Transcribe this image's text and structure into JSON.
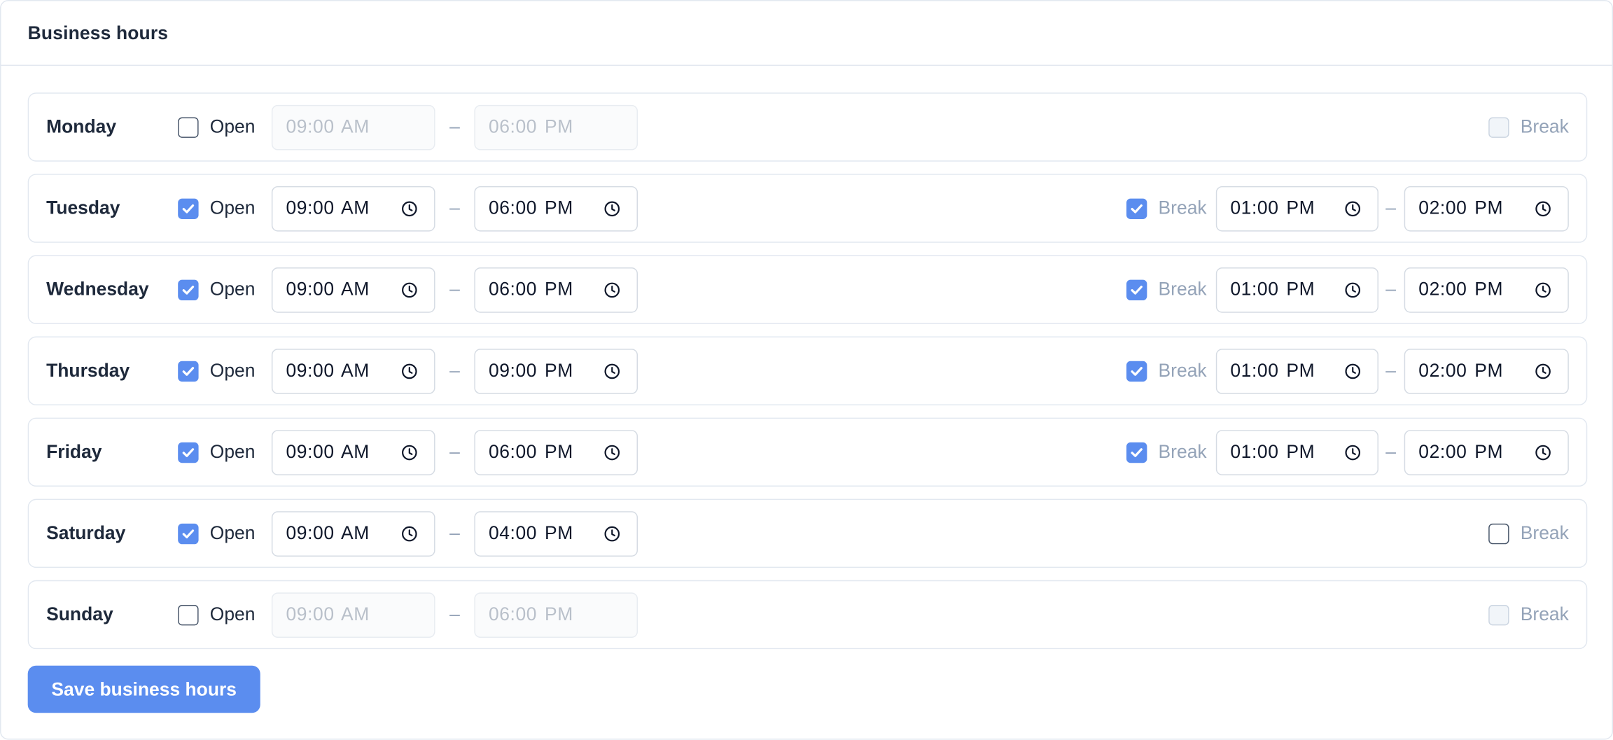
{
  "card": {
    "title": "Business hours"
  },
  "labels": {
    "open": "Open",
    "break": "Break",
    "separator": "–"
  },
  "days": [
    {
      "name": "Monday",
      "open": false,
      "open_time": "09:00 AM",
      "close_time": "06:00 PM",
      "break": false,
      "break_enabled": false,
      "break_start": "",
      "break_end": ""
    },
    {
      "name": "Tuesday",
      "open": true,
      "open_time": "09:00 AM",
      "close_time": "06:00 PM",
      "break": true,
      "break_enabled": true,
      "break_start": "01:00 PM",
      "break_end": "02:00 PM"
    },
    {
      "name": "Wednesday",
      "open": true,
      "open_time": "09:00 AM",
      "close_time": "06:00 PM",
      "break": true,
      "break_enabled": true,
      "break_start": "01:00 PM",
      "break_end": "02:00 PM"
    },
    {
      "name": "Thursday",
      "open": true,
      "open_time": "09:00 AM",
      "close_time": "09:00 PM",
      "break": true,
      "break_enabled": true,
      "break_start": "01:00 PM",
      "break_end": "02:00 PM"
    },
    {
      "name": "Friday",
      "open": true,
      "open_time": "09:00 AM",
      "close_time": "06:00 PM",
      "break": true,
      "break_enabled": true,
      "break_start": "01:00 PM",
      "break_end": "02:00 PM"
    },
    {
      "name": "Saturday",
      "open": true,
      "open_time": "09:00 AM",
      "close_time": "04:00 PM",
      "break": false,
      "break_enabled": true,
      "break_start": "",
      "break_end": ""
    },
    {
      "name": "Sunday",
      "open": false,
      "open_time": "09:00 AM",
      "close_time": "06:00 PM",
      "break": false,
      "break_enabled": false,
      "break_start": "",
      "break_end": ""
    }
  ],
  "actions": {
    "save_label": "Save business hours"
  },
  "colors": {
    "accent": "#5b8def",
    "border": "#e2e8f0",
    "text": "#1e293b",
    "muted": "#94a3b8"
  },
  "icons": {
    "time_input": "clock-icon",
    "checkbox_checked": "checkmark-icon"
  }
}
